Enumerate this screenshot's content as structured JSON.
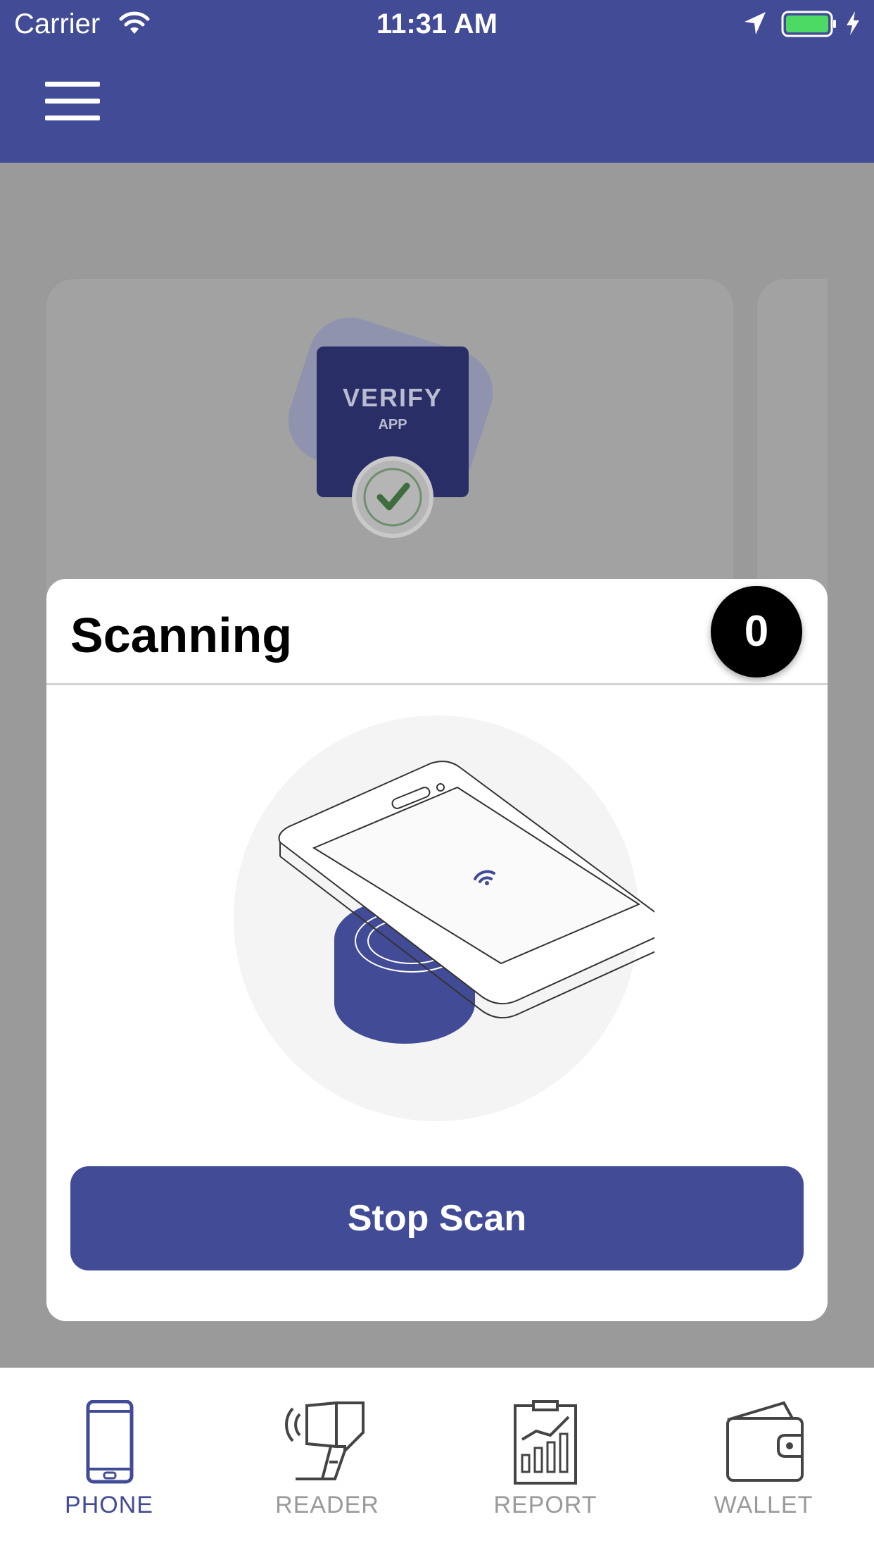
{
  "status_bar": {
    "carrier": "Carrier",
    "time": "11:31 AM"
  },
  "background_card": {
    "logo_title": "VERIFY",
    "logo_subtitle": "APP"
  },
  "modal": {
    "title": "Scanning",
    "count": "0",
    "stop_button_label": "Stop Scan"
  },
  "tab_bar": {
    "items": [
      {
        "label": "PHONE",
        "icon": "phone-icon",
        "active": true
      },
      {
        "label": "READER",
        "icon": "reader-icon",
        "active": false
      },
      {
        "label": "REPORT",
        "icon": "report-icon",
        "active": false
      },
      {
        "label": "WALLET",
        "icon": "wallet-icon",
        "active": false
      }
    ]
  },
  "colors": {
    "primary": "#424b96",
    "overlay_bg": "#9a9a9a",
    "battery": "#4cd964",
    "inactive_tab": "#9a9a9a"
  }
}
